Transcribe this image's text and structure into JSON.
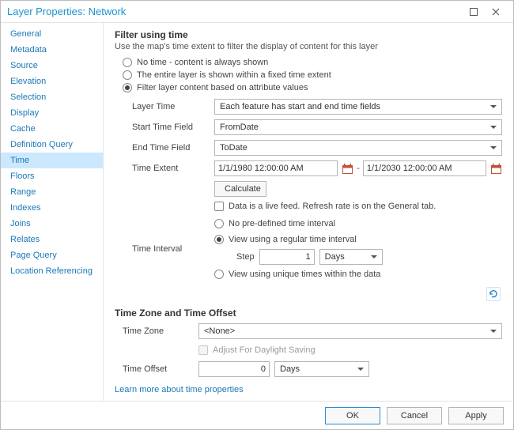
{
  "window": {
    "title": "Layer Properties: Network"
  },
  "sidebar": {
    "items": [
      {
        "label": "General"
      },
      {
        "label": "Metadata"
      },
      {
        "label": "Source"
      },
      {
        "label": "Elevation"
      },
      {
        "label": "Selection"
      },
      {
        "label": "Display"
      },
      {
        "label": "Cache"
      },
      {
        "label": "Definition Query"
      },
      {
        "label": "Time"
      },
      {
        "label": "Floors"
      },
      {
        "label": "Range"
      },
      {
        "label": "Indexes"
      },
      {
        "label": "Joins"
      },
      {
        "label": "Relates"
      },
      {
        "label": "Page Query"
      },
      {
        "label": "Location Referencing"
      }
    ],
    "selected_index": 8
  },
  "filter": {
    "heading": "Filter using time",
    "subheading": "Use the map's time extent to filter the display of content for this layer",
    "options": {
      "none": "No time - content is always shown",
      "fixed": "The entire layer is shown within a fixed time extent",
      "attr": "Filter layer content based on attribute values"
    },
    "selected": "attr"
  },
  "fields": {
    "layer_time_label": "Layer Time",
    "layer_time_value": "Each feature has start and end time fields",
    "start_label": "Start Time Field",
    "start_value": "FromDate",
    "end_label": "End Time Field",
    "end_value": "ToDate",
    "extent_label": "Time Extent",
    "extent_start": "1/1/1980 12:00:00 AM",
    "extent_sep": "-",
    "extent_end": "1/1/2030 12:00:00 AM",
    "calculate": "Calculate",
    "livefeed": "Data is a live feed. Refresh rate is on the General tab.",
    "interval_label": "Time Interval",
    "interval_none": "No pre-defined time interval",
    "interval_regular": "View using a regular time interval",
    "step_label": "Step",
    "step_value": "1",
    "step_unit": "Days",
    "interval_unique": "View using unique times within the data"
  },
  "tz": {
    "heading": "Time Zone and Time Offset",
    "zone_label": "Time Zone",
    "zone_value": "<None>",
    "dst": "Adjust For Daylight Saving",
    "offset_label": "Time Offset",
    "offset_value": "0",
    "offset_unit": "Days"
  },
  "link": {
    "learn_more": "Learn more about time properties"
  },
  "footer": {
    "ok": "OK",
    "cancel": "Cancel",
    "apply": "Apply"
  }
}
